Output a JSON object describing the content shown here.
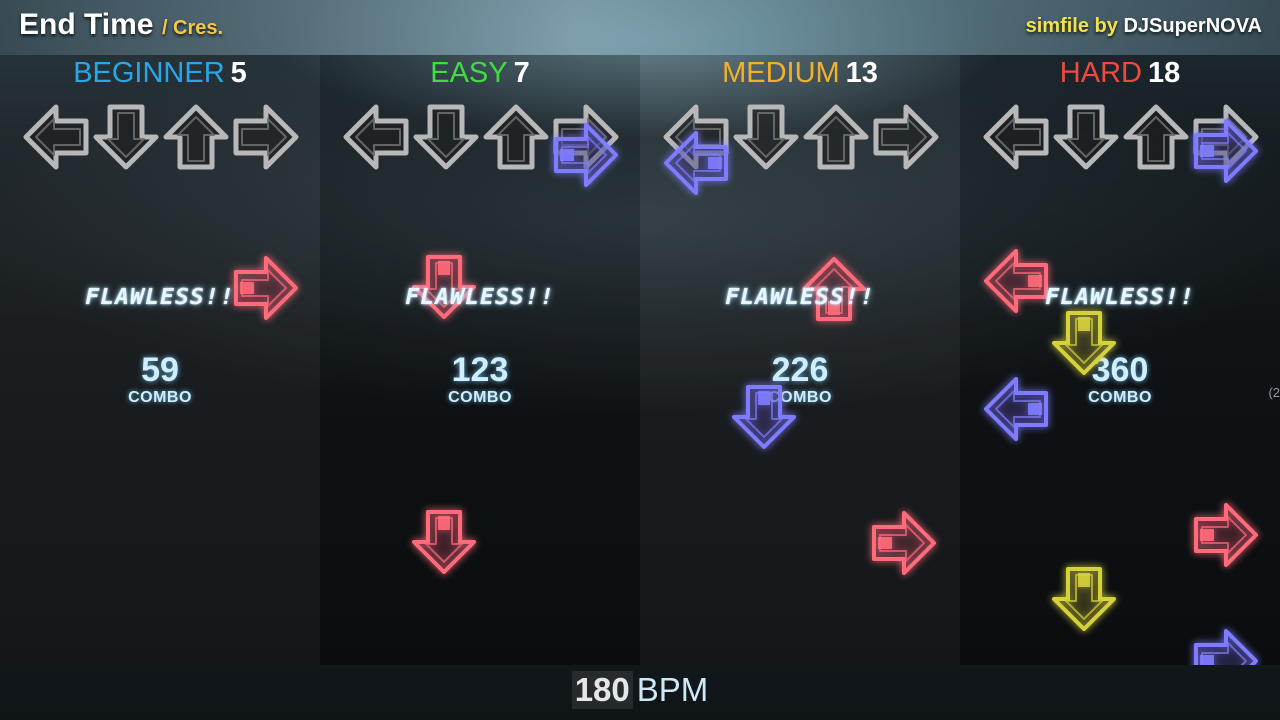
{
  "header": {
    "song_title": "End Time",
    "song_artist": "/ Cres.",
    "simfile_prefix": "simfile by",
    "simfile_author": "DJSuperNOVA"
  },
  "charts": [
    {
      "difficulty": "BEGINNER",
      "level": "5",
      "color": "#27a7e8",
      "judgment": "FLAWLESS!!",
      "combo": "59",
      "combo_label": "COMBO"
    },
    {
      "difficulty": "EASY",
      "level": "7",
      "color": "#3fdc43",
      "judgment": "FLAWLESS!!",
      "combo": "123",
      "combo_label": "COMBO"
    },
    {
      "difficulty": "MEDIUM",
      "level": "13",
      "color": "#f3b12a",
      "judgment": "FLAWLESS!!",
      "combo": "226",
      "combo_label": "COMBO"
    },
    {
      "difficulty": "HARD",
      "level": "18",
      "color": "#ef4a3d",
      "judgment": "FLAWLESS!!",
      "combo": "360",
      "combo_label": "COMBO"
    }
  ],
  "edge_glyph": "(2",
  "footer": {
    "bpm_value": "180",
    "bpm_unit": "BPM"
  },
  "note_colors": {
    "red": "#ff6b7a",
    "blue": "#7f7cff",
    "yellow": "#d6d23a",
    "receptor": "#b8b8b8"
  },
  "receptor_directions": [
    "left",
    "down",
    "up",
    "right"
  ],
  "notes": [
    {
      "lane": 0,
      "direction": "right",
      "color": "red"
    },
    {
      "lane": 1,
      "direction": "right",
      "color": "blue"
    },
    {
      "lane": 1,
      "direction": "down",
      "color": "red"
    },
    {
      "lane": 1,
      "direction": "down",
      "color": "red"
    },
    {
      "lane": 2,
      "direction": "left",
      "color": "blue"
    },
    {
      "lane": 2,
      "direction": "up",
      "color": "red"
    },
    {
      "lane": 2,
      "direction": "down",
      "color": "blue"
    },
    {
      "lane": 2,
      "direction": "right",
      "color": "red"
    },
    {
      "lane": 3,
      "direction": "right",
      "color": "blue"
    },
    {
      "lane": 3,
      "direction": "left",
      "color": "red"
    },
    {
      "lane": 3,
      "direction": "down",
      "color": "yellow"
    },
    {
      "lane": 3,
      "direction": "left",
      "color": "blue"
    },
    {
      "lane": 3,
      "direction": "right",
      "color": "red"
    },
    {
      "lane": 3,
      "direction": "down",
      "color": "yellow"
    },
    {
      "lane": 3,
      "direction": "right",
      "color": "blue"
    }
  ]
}
